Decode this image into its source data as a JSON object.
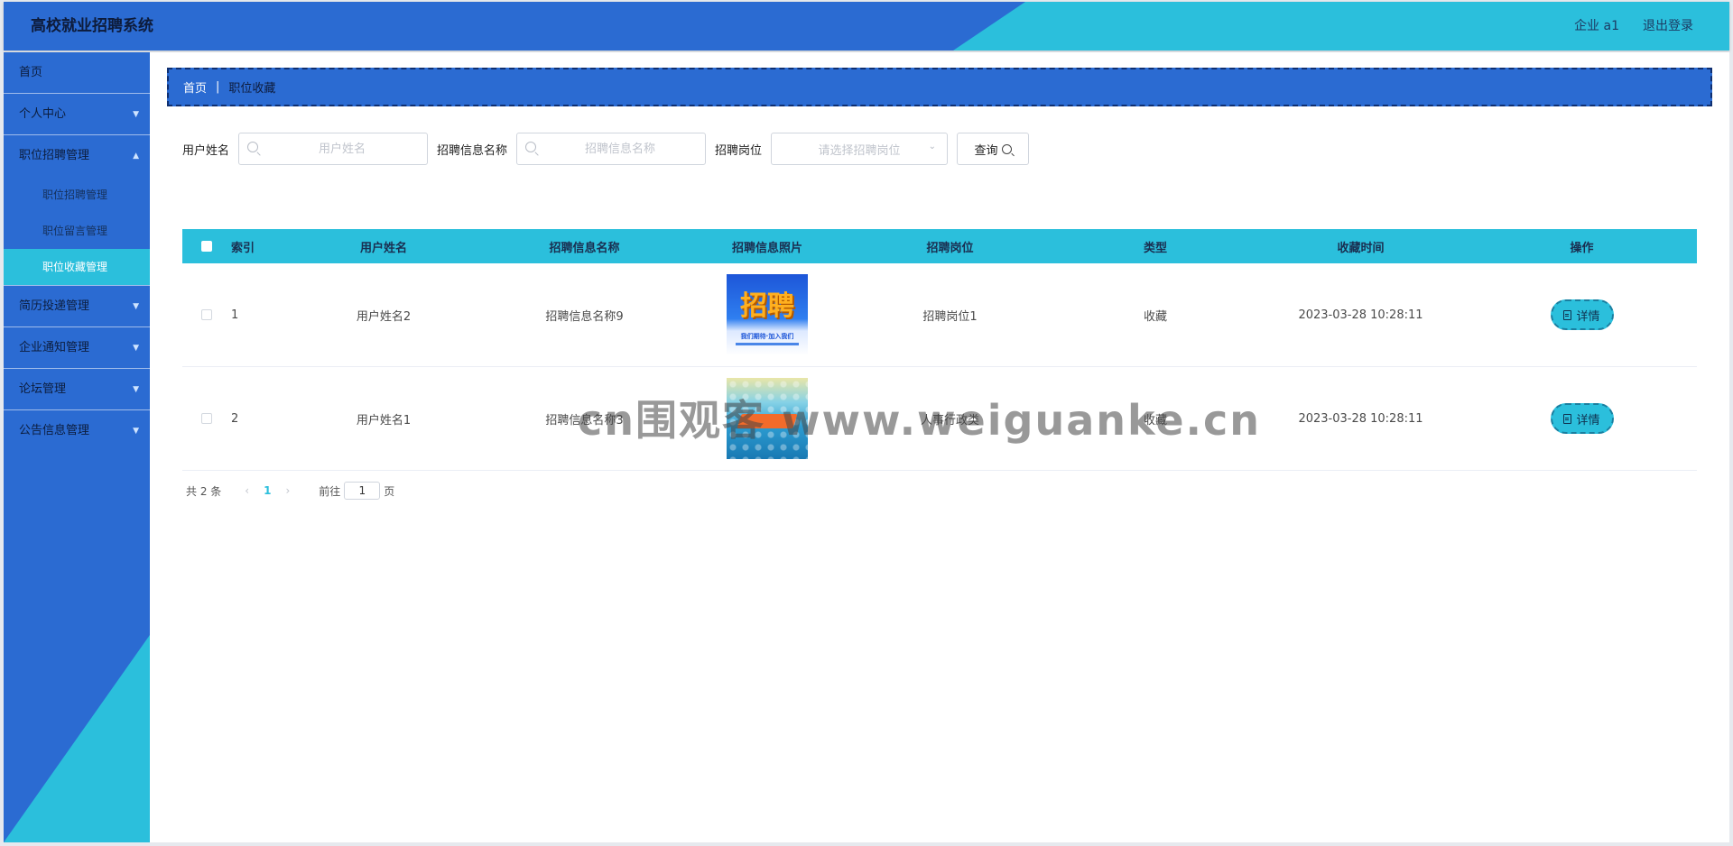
{
  "header": {
    "app_title": "高校就业招聘系统",
    "user_label": "企业 a1",
    "logout_label": "退出登录",
    "colors": {
      "primary": "#2b6bd2",
      "accent": "#2bbfdc"
    }
  },
  "sidebar": {
    "items": [
      {
        "label": "首页",
        "chevron": ""
      },
      {
        "label": "个人中心",
        "chevron": "⌄"
      },
      {
        "label": "职位招聘管理",
        "chevron": "⌃"
      },
      {
        "label": "简历投递管理",
        "chevron": "⌄"
      },
      {
        "label": "企业通知管理",
        "chevron": "⌄"
      },
      {
        "label": "论坛管理",
        "chevron": "⌄"
      },
      {
        "label": "公告信息管理",
        "chevron": "⌄"
      }
    ],
    "subitems": [
      {
        "label": "职位招聘管理"
      },
      {
        "label": "职位留言管理"
      },
      {
        "label": "职位收藏管理"
      }
    ]
  },
  "breadcrumb": {
    "home": "首页",
    "separator": "|",
    "current": "职位收藏"
  },
  "filters": {
    "user_name_label": "用户姓名",
    "user_name_placeholder": "用户姓名",
    "job_name_label": "招聘信息名称",
    "job_name_placeholder": "招聘信息名称",
    "post_label": "招聘岗位",
    "post_placeholder": "请选择招聘岗位",
    "query_label": "查询"
  },
  "table": {
    "columns": [
      "索引",
      "用户姓名",
      "招聘信息名称",
      "招聘信息照片",
      "招聘岗位",
      "类型",
      "收藏时间",
      "操作"
    ],
    "rows": [
      {
        "index": "1",
        "user": "用户姓名2",
        "name": "招聘信息名称9",
        "post": "招聘岗位1",
        "type": "收藏",
        "time": "2023-03-28 10:28:11",
        "op": "详情"
      },
      {
        "index": "2",
        "user": "用户姓名1",
        "name": "招聘信息名称3",
        "post": "人事行政类",
        "type": "收藏",
        "time": "2023-03-28 10:28:11",
        "op": "详情"
      }
    ],
    "thumb_1_text": "招聘",
    "thumb_1_caption": "我们期待·加入我们"
  },
  "pagination": {
    "total": "共 2 条",
    "prev": "‹",
    "page": "1",
    "next": "›",
    "goto_label": "前往",
    "goto_value": "1",
    "page_suffix": "页"
  },
  "watermark": "cn围观客 www.weiguanke.cn"
}
